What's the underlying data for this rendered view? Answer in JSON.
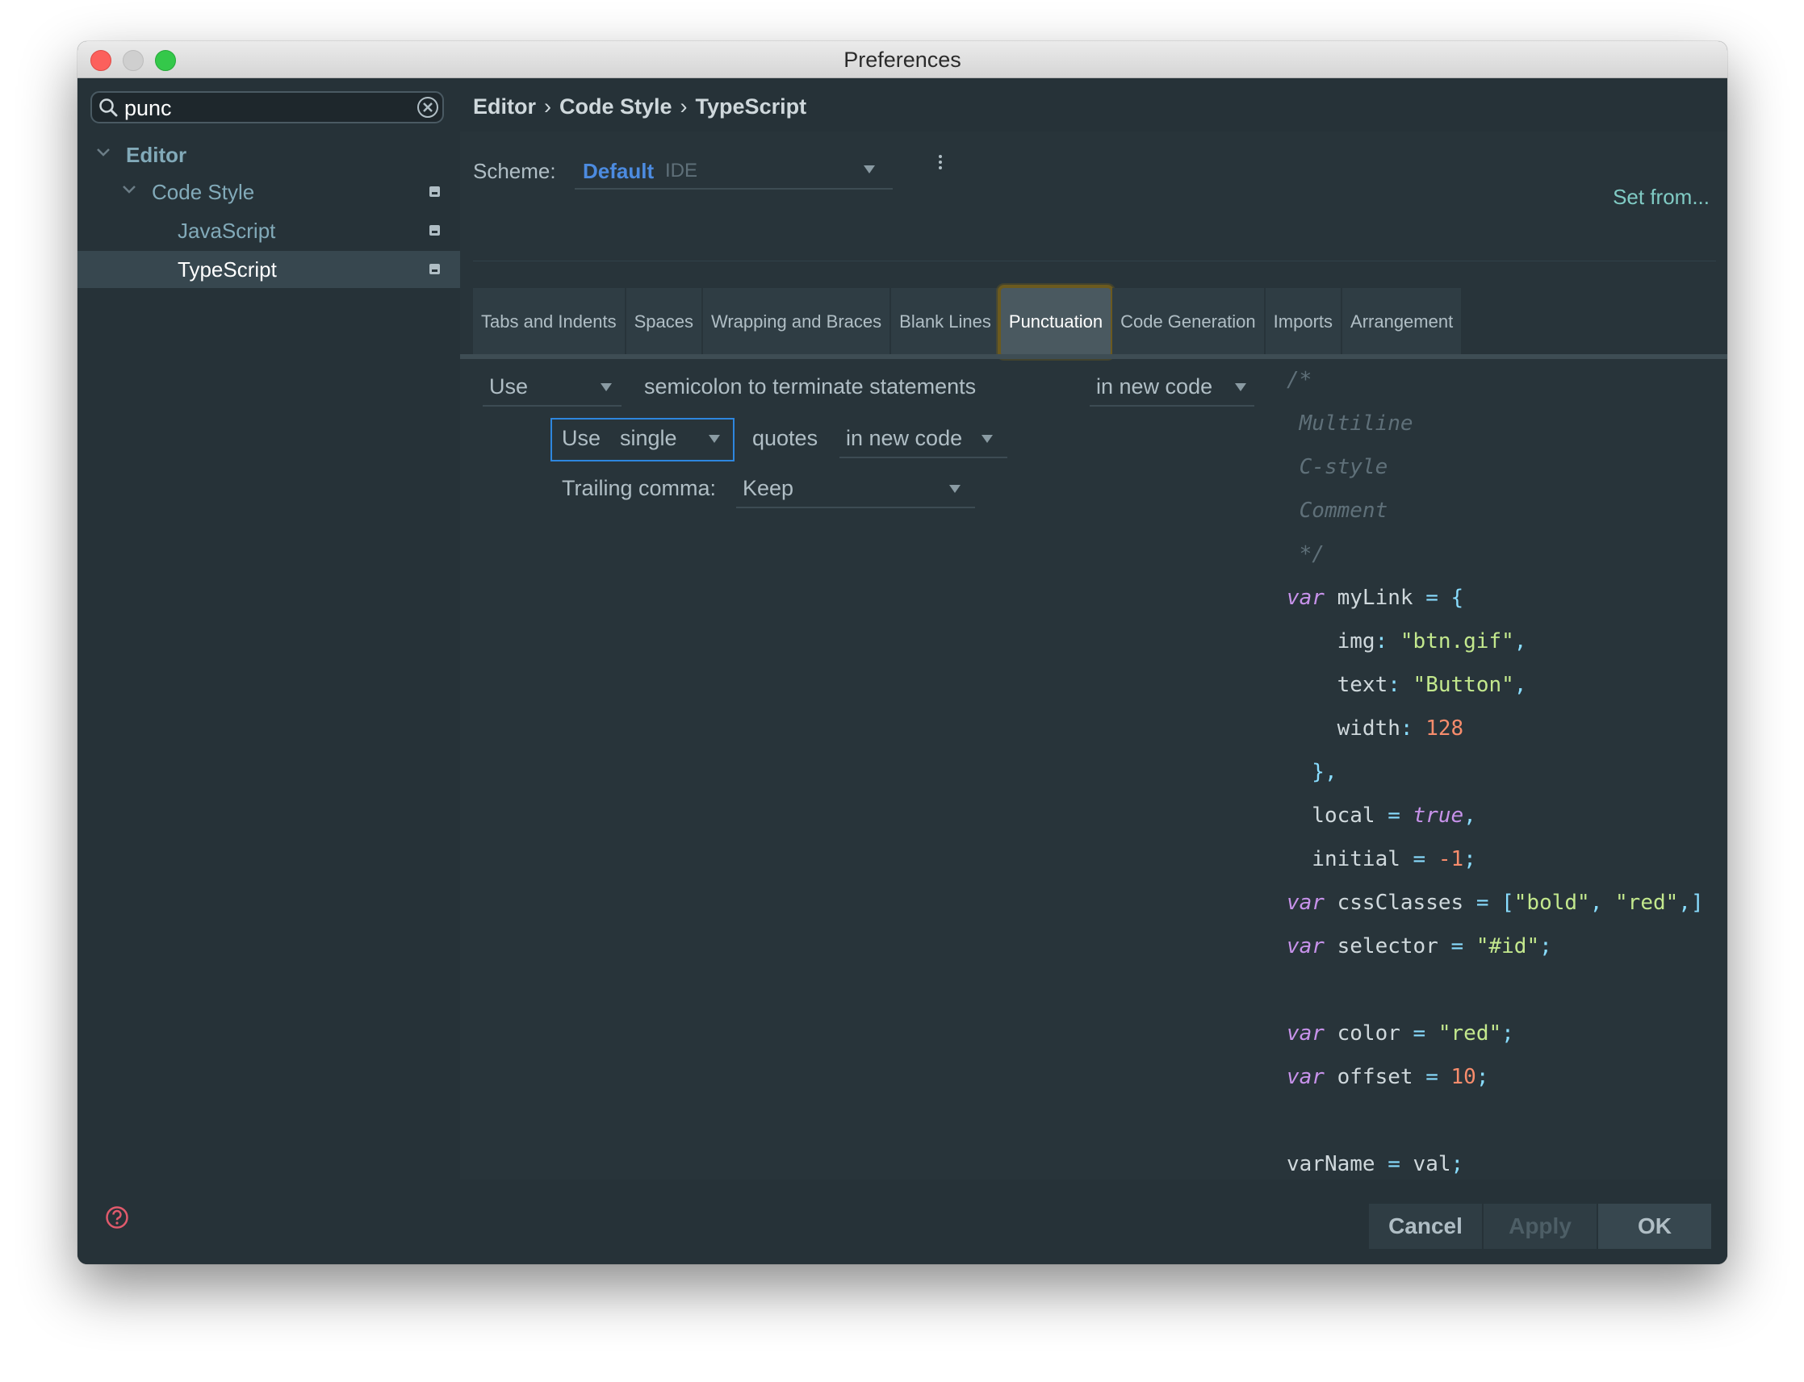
{
  "window": {
    "title": "Preferences"
  },
  "sidebar": {
    "search_value": "punc",
    "tree": [
      {
        "label": "Editor",
        "color": "#82aab9"
      },
      {
        "label": "Code Style",
        "color": "#82aab9"
      },
      {
        "label": "JavaScript",
        "color": "#82aab9"
      },
      {
        "label": "TypeScript",
        "color": "#ffffff",
        "selected": true
      }
    ]
  },
  "breadcrumb": [
    "Editor",
    "Code Style",
    "TypeScript"
  ],
  "scheme": {
    "label": "Scheme:",
    "name": "Default",
    "type": "IDE",
    "set_from": "Set from..."
  },
  "tabs": [
    {
      "label": "Tabs and Indents"
    },
    {
      "label": "Spaces"
    },
    {
      "label": "Wrapping and Braces"
    },
    {
      "label": "Blank Lines"
    },
    {
      "label": "Punctuation",
      "active": true
    },
    {
      "label": "Code Generation"
    },
    {
      "label": "Imports"
    },
    {
      "label": "Arrangement"
    }
  ],
  "options": {
    "semicolon_select": "Use",
    "semicolon_text": "semicolon to terminate statements",
    "semicolon_scope": "in new code",
    "quotes_prefix": "Use",
    "quotes_select": "single",
    "quotes_text": "quotes",
    "quotes_scope": "in new code",
    "trailing_label": "Trailing comma:",
    "trailing_select": "Keep"
  },
  "buttons": {
    "cancel": "Cancel",
    "apply": "Apply",
    "ok": "OK"
  },
  "colors": {
    "background": "#263238",
    "accent_blue": "#4c8be0",
    "keyword": "#c792ea",
    "string": "#c3e88d",
    "number": "#f78c6c",
    "comment": "#5f7079",
    "focus_outline": "#2e86de",
    "tab_highlight": "#6b5a1f"
  },
  "code_preview": [
    [
      [
        "/*",
        "comment"
      ]
    ],
    [
      [
        " Multiline",
        "comment"
      ]
    ],
    [
      [
        " C-style",
        "comment"
      ]
    ],
    [
      [
        " Comment",
        "comment"
      ]
    ],
    [
      [
        " */",
        "comment"
      ]
    ],
    [
      [
        "var",
        "kw"
      ],
      [
        " myLink ",
        "plain"
      ],
      [
        "= {",
        "punc"
      ]
    ],
    [
      [
        "    img",
        "plain"
      ],
      [
        ": ",
        "punc"
      ],
      [
        "\"btn.gif\"",
        "str"
      ],
      [
        ",",
        "punc"
      ]
    ],
    [
      [
        "    text",
        "plain"
      ],
      [
        ": ",
        "punc"
      ],
      [
        "\"Button\"",
        "str"
      ],
      [
        ",",
        "punc"
      ]
    ],
    [
      [
        "    width",
        "plain"
      ],
      [
        ": ",
        "punc"
      ],
      [
        "128",
        "num"
      ]
    ],
    [
      [
        "  },",
        "punc"
      ]
    ],
    [
      [
        "  local ",
        "plain"
      ],
      [
        "= ",
        "punc"
      ],
      [
        "true",
        "kw"
      ],
      [
        ",",
        "punc"
      ]
    ],
    [
      [
        "  initial ",
        "plain"
      ],
      [
        "= ",
        "punc"
      ],
      [
        "-1",
        "num"
      ],
      [
        ";",
        "punc"
      ]
    ],
    [
      [
        "var",
        "kw"
      ],
      [
        " cssClasses ",
        "plain"
      ],
      [
        "= [",
        "punc"
      ],
      [
        "\"bold\"",
        "str"
      ],
      [
        ", ",
        "punc"
      ],
      [
        "\"red\"",
        "str"
      ],
      [
        ",]",
        "punc"
      ]
    ],
    [
      [
        "var",
        "kw"
      ],
      [
        " selector ",
        "plain"
      ],
      [
        "= ",
        "punc"
      ],
      [
        "\"#id\"",
        "str"
      ],
      [
        ";",
        "punc"
      ]
    ],
    [],
    [
      [
        "var",
        "kw"
      ],
      [
        " color ",
        "plain"
      ],
      [
        "= ",
        "punc"
      ],
      [
        "\"red\"",
        "str"
      ],
      [
        ";",
        "punc"
      ]
    ],
    [
      [
        "var",
        "kw"
      ],
      [
        " offset ",
        "plain"
      ],
      [
        "= ",
        "punc"
      ],
      [
        "10",
        "num"
      ],
      [
        ";",
        "punc"
      ]
    ],
    [],
    [
      [
        "varName ",
        "plain"
      ],
      [
        "= ",
        "punc"
      ],
      [
        "val",
        "plain"
      ],
      [
        ";",
        "punc"
      ]
    ]
  ]
}
